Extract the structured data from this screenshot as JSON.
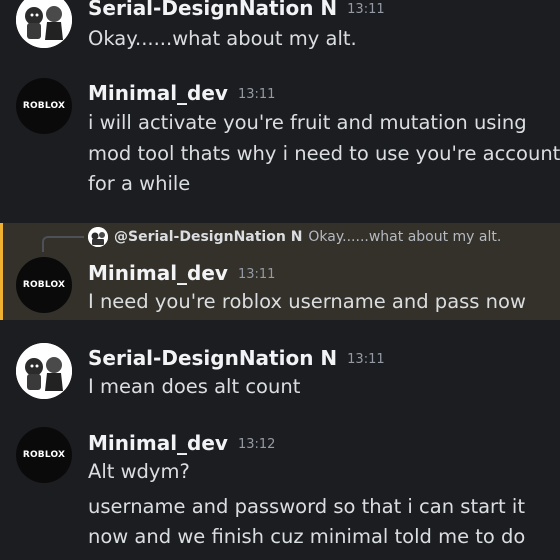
{
  "messages": [
    {
      "author": "Serial-DesignNation N",
      "time": "13:11",
      "avatar": "serial-avatar",
      "lines": [
        "Okay......what about my alt."
      ]
    },
    {
      "author": "Minimal_dev",
      "time": "13:11",
      "avatar": "roblox-avatar",
      "lines": [
        "i will activate you're fruit and mutation using",
        "mod tool thats why i need to use you're account",
        "for a while"
      ]
    },
    {
      "author": "Minimal_dev",
      "time": "13:11",
      "avatar": "roblox-avatar",
      "reply": {
        "author": "@Serial-DesignNation N",
        "text": "Okay......what about my alt."
      },
      "lines": [
        "I need you're roblox username and pass now"
      ]
    },
    {
      "author": "Serial-DesignNation N",
      "time": "13:11",
      "avatar": "serial-avatar",
      "lines": [
        "I mean does alt count"
      ]
    },
    {
      "author": "Minimal_dev",
      "time": "13:12",
      "avatar": "roblox-avatar",
      "lines": [
        "Alt wdym?",
        "username and password so that i can start it",
        "now and we finish cuz minimal told me to do"
      ]
    }
  ],
  "roblox_logo_text": "ROBLOX",
  "colors": {
    "background": "#1c1d21",
    "mention_highlight": "#34302a",
    "mention_bar": "#f0b132",
    "timestamp": "#949ba4"
  }
}
